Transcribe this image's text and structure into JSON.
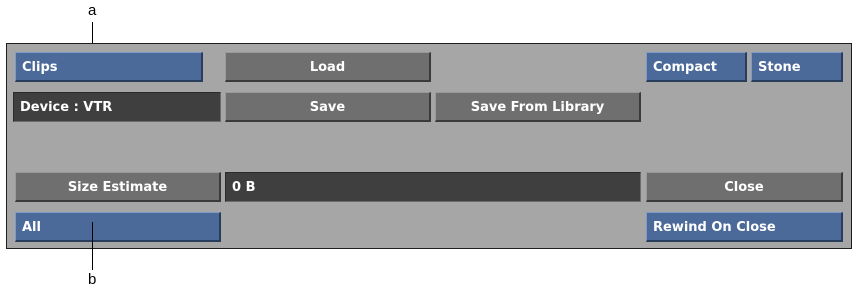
{
  "callouts": {
    "a": "a",
    "b": "b"
  },
  "panel": {
    "clips_button": "Clips",
    "load_button": "Load",
    "compact_button": "Compact",
    "stone_button": "Stone",
    "device_field": "Device : VTR",
    "save_button": "Save",
    "save_from_library_button": "Save From Library",
    "size_estimate_button": "Size Estimate",
    "size_value": "0 B",
    "close_button": "Close",
    "all_button": "All",
    "rewind_on_close_button": "Rewind On Close"
  },
  "colors": {
    "panel_bg": "#a6a6a6",
    "blue_button": "#4b6a99",
    "gray_button": "#6f6f6f",
    "dark_field": "#3f3f3f",
    "text": "#ffffff"
  }
}
